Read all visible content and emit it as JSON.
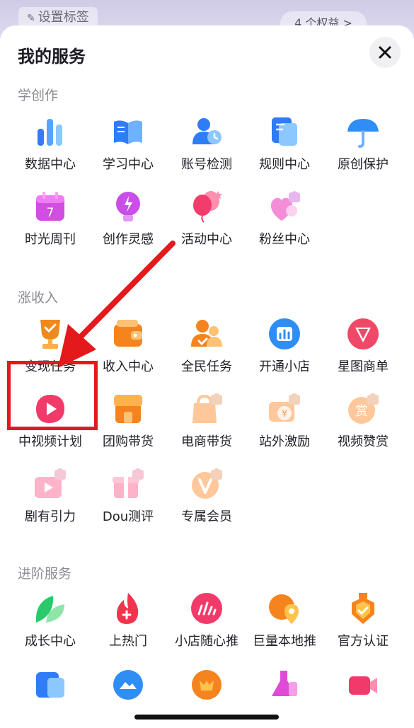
{
  "background": {
    "tag_label": "设置标签",
    "rights_label": "4 个权益 >"
  },
  "sheet": {
    "title": "我的服务"
  },
  "sections": [
    {
      "title": "学创作",
      "items": [
        {
          "label": "数据中心",
          "icon": "bar-chart-icon"
        },
        {
          "label": "学习中心",
          "icon": "open-book-icon"
        },
        {
          "label": "账号检测",
          "icon": "user-check-icon"
        },
        {
          "label": "规则中心",
          "icon": "document-icon"
        },
        {
          "label": "原创保护",
          "icon": "umbrella-icon"
        },
        {
          "label": "时光周刊",
          "icon": "calendar-icon"
        },
        {
          "label": "创作灵感",
          "icon": "lightbulb-icon"
        },
        {
          "label": "活动中心",
          "icon": "balloon-icon"
        },
        {
          "label": "粉丝中心",
          "icon": "heart-icon"
        }
      ]
    },
    {
      "title": "涨收入",
      "items": [
        {
          "label": "变现任务",
          "icon": "trophy-icon"
        },
        {
          "label": "收入中心",
          "icon": "wallet-icon"
        },
        {
          "label": "全民任务",
          "icon": "people-icon"
        },
        {
          "label": "开通小店",
          "icon": "shop-icon"
        },
        {
          "label": "星图商单",
          "icon": "star-map-icon"
        },
        {
          "label": "中视频计划",
          "icon": "play-icon"
        },
        {
          "label": "团购带货",
          "icon": "storefront-icon"
        },
        {
          "label": "电商带货",
          "icon": "shopping-bag-icon"
        },
        {
          "label": "站外激励",
          "icon": "coin-icon"
        },
        {
          "label": "视频赞赏",
          "icon": "reward-icon"
        },
        {
          "label": "剧有引力",
          "icon": "film-icon"
        },
        {
          "label": "Dou测评",
          "icon": "gift-icon"
        },
        {
          "label": "专属会员",
          "icon": "vip-icon"
        }
      ]
    },
    {
      "title": "进阶服务",
      "items": [
        {
          "label": "成长中心",
          "icon": "leaf-icon"
        },
        {
          "label": "上热门",
          "icon": "flame-icon"
        },
        {
          "label": "小店随心推",
          "icon": "boost-icon"
        },
        {
          "label": "巨量本地推",
          "icon": "location-icon"
        },
        {
          "label": "官方认证",
          "icon": "badge-icon"
        }
      ]
    }
  ],
  "colors": {
    "highlight_border": "#e4191c",
    "arrow": "#e4191c",
    "section_title": "#8a8a93"
  }
}
